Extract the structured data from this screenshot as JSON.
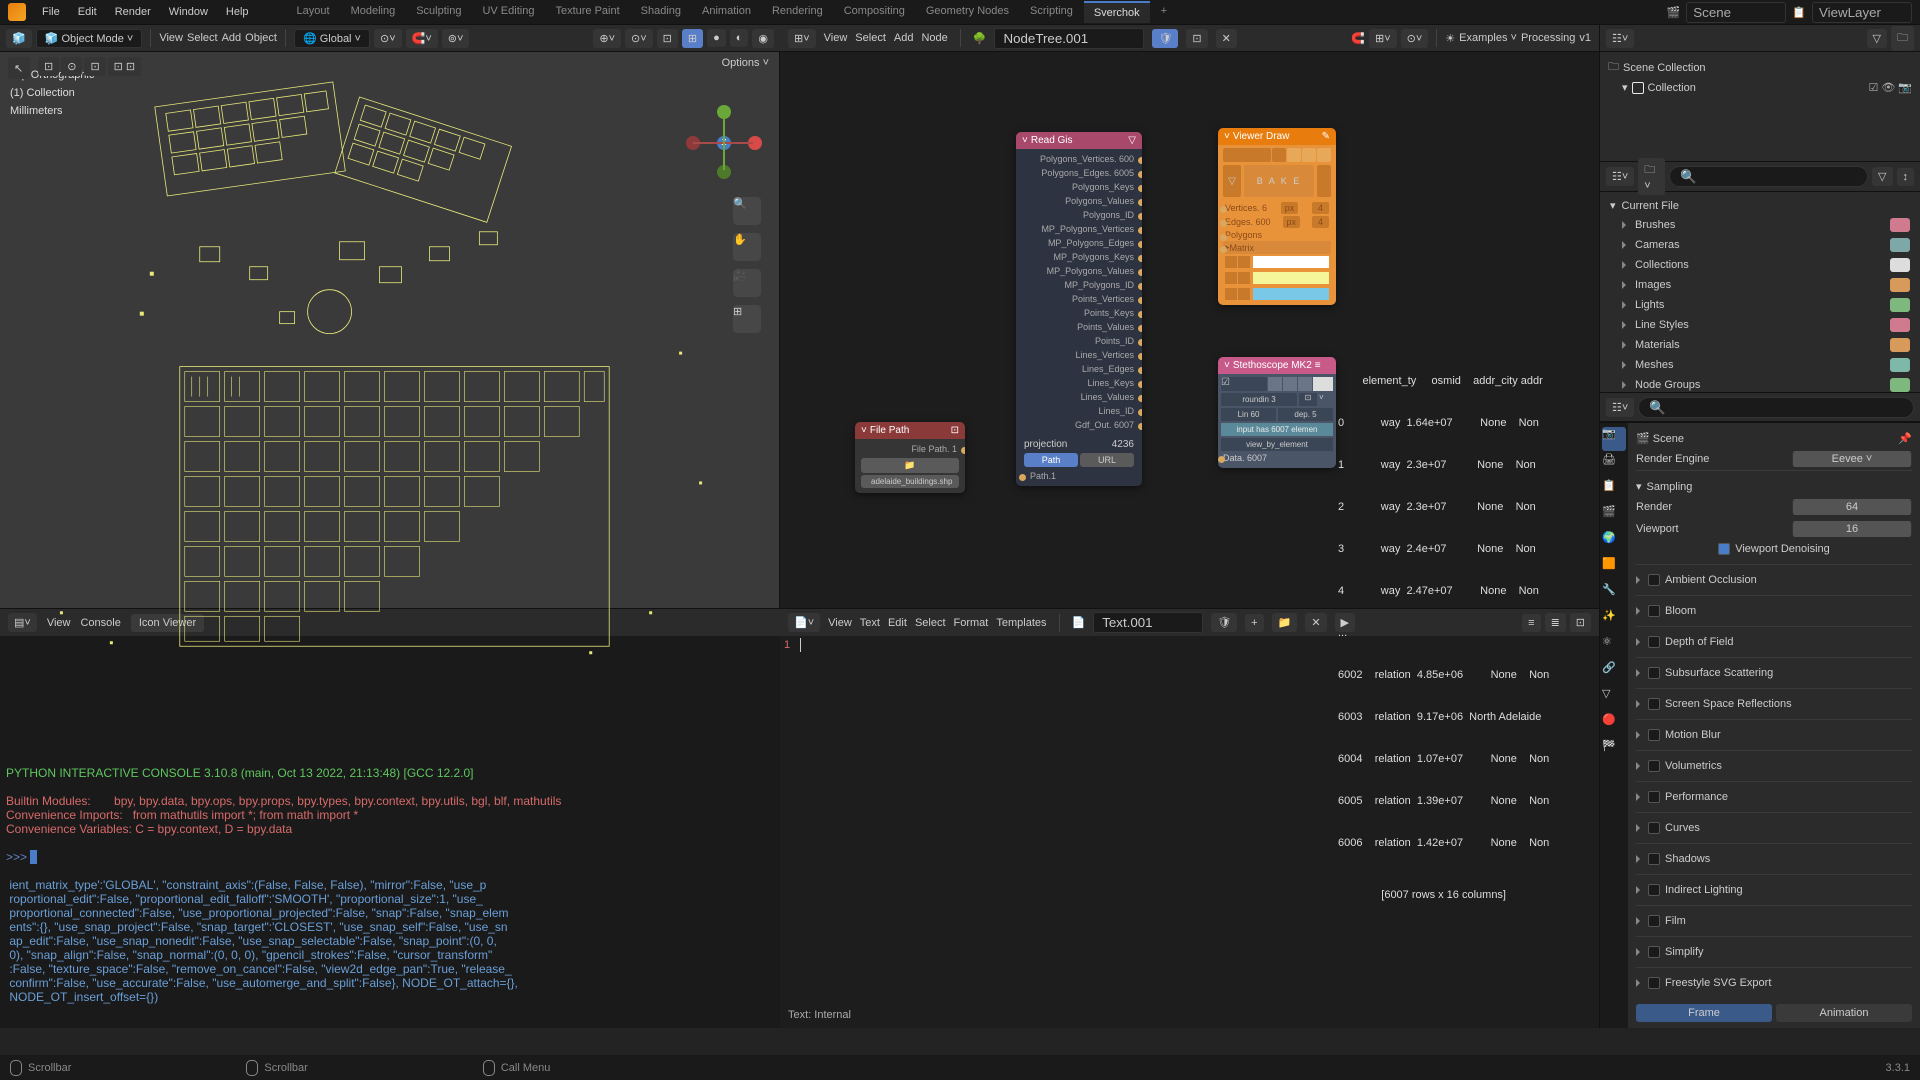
{
  "topbar": {
    "menus": [
      "File",
      "Edit",
      "Render",
      "Window",
      "Help"
    ],
    "workspaces": [
      "Layout",
      "Modeling",
      "Sculpting",
      "UV Editing",
      "Texture Paint",
      "Shading",
      "Animation",
      "Rendering",
      "Compositing",
      "Geometry Nodes",
      "Scripting",
      "Sverchok",
      "+"
    ],
    "active_ws": "Sverchok",
    "scene": "Scene",
    "viewlayer": "ViewLayer"
  },
  "viewport": {
    "mode": "Object Mode",
    "menus": [
      "View",
      "Select",
      "Add",
      "Object"
    ],
    "orientation": "Global",
    "options": "Options",
    "overlay": {
      "l1": "Top Orthographic",
      "l2": "(1) Collection",
      "l3": "Millimeters"
    }
  },
  "node_editor": {
    "menus": [
      "View",
      "Select",
      "Add",
      "Node"
    ],
    "treename": "NodeTree.001",
    "examples": "Examples",
    "processing": "Processing",
    "v": "v1"
  },
  "nodes": {
    "readgis": {
      "title": "Read Gis",
      "outputs": [
        {
          "label": "Polygons_Vertices",
          "val": "600"
        },
        {
          "label": "Polygons_Edges",
          "val": "6005"
        },
        {
          "label": "Polygons_Keys",
          "val": ""
        },
        {
          "label": "Polygons_Values",
          "val": ""
        },
        {
          "label": "Polygons_ID",
          "val": ""
        },
        {
          "label": "MP_Polygons_Vertices",
          "val": ""
        },
        {
          "label": "MP_Polygons_Edges",
          "val": ""
        },
        {
          "label": "MP_Polygons_Keys",
          "val": ""
        },
        {
          "label": "MP_Polygons_Values",
          "val": ""
        },
        {
          "label": "MP_Polygons_ID",
          "val": ""
        },
        {
          "label": "Points_Vertices",
          "val": ""
        },
        {
          "label": "Points_Keys",
          "val": ""
        },
        {
          "label": "Points_Values",
          "val": ""
        },
        {
          "label": "Points_ID",
          "val": ""
        },
        {
          "label": "Lines_Vertices",
          "val": ""
        },
        {
          "label": "Lines_Edges",
          "val": ""
        },
        {
          "label": "Lines_Keys",
          "val": ""
        },
        {
          "label": "Lines_Values",
          "val": ""
        },
        {
          "label": "Lines_ID",
          "val": ""
        },
        {
          "label": "Gdf_Out",
          "val": "6007"
        }
      ],
      "projection": "projection",
      "proj_val": "4236",
      "tab_path": "Path",
      "tab_url": "URL",
      "path_label": "Path",
      "path_val": "1"
    },
    "viewer": {
      "title": "Viewer Draw",
      "bake": "B A K E",
      "vertices": "Vertices. 6",
      "edges": "Edges. 600",
      "polygons": "Polygons",
      "matrix": "Matrix",
      "px": "px",
      "px_val1": "4",
      "px_val2": "4"
    },
    "filepath": {
      "title": "File Path",
      "socket": "File Path",
      "socket_val": "1",
      "value": "adelaide_buildings.shp"
    },
    "stetho": {
      "title": "Stethoscope MK2",
      "rounding": "roundin",
      "rounding_val": "3",
      "lin": "Lin 60",
      "dep": "dep. 5",
      "msg": "input has 6007 elemen",
      "view_by": "view_by_element",
      "data": "Data. 6007"
    }
  },
  "node_table": {
    "header": "        element_ty     osmid    addr_city addr",
    "rows": [
      "0            way  1.64e+07         None    Non",
      "1            way  2.3e+07          None    Non",
      "2            way  2.3e+07          None    Non",
      "3            way  2.4e+07          None    Non",
      "4            way  2.47e+07         None    Non",
      "...",
      "6002    relation  4.85e+06         None    Non",
      "6003    relation  9.17e+06  North Adelaide",
      "6004    relation  1.07e+07         None    Non",
      "6005    relation  1.39e+07         None    Non",
      "6006    relation  1.42e+07         None    Non"
    ],
    "footer": "[6007 rows x 16 columns]"
  },
  "console": {
    "menus": [
      "View",
      "Console"
    ],
    "tab": "Icon Viewer",
    "startup": "PYTHON INTERACTIVE CONSOLE 3.10.8 (main, Oct 13 2022, 21:13:48) [GCC 12.2.0]",
    "builtin": "Builtin Modules:       bpy, bpy.data, bpy.ops, bpy.props, bpy.types, bpy.context, bpy.utils, bgl, blf, mathutils",
    "conv1": "Convenience Imports:   from mathutils import *; from math import *",
    "conv2": "Convenience Variables: C = bpy.context, D = bpy.data",
    "prompt": ">>> ",
    "dump": [
      " ient_matrix_type':'GLOBAL', \"constraint_axis\":(False, False, False), \"mirror\":False, \"use_p",
      " roportional_edit\":False, \"proportional_edit_falloff\":'SMOOTH', \"proportional_size\":1, \"use_",
      " proportional_connected\":False, \"use_proportional_projected\":False, \"snap\":False, \"snap_elem",
      " ents\":{}, \"use_snap_project\":False, \"snap_target\":'CLOSEST', \"use_snap_self\":False, \"use_sn",
      " ap_edit\":False, \"use_snap_nonedit\":False, \"use_snap_selectable\":False, \"snap_point\":(0, 0, ",
      " 0), \"snap_align\":False, \"snap_normal\":(0, 0, 0), \"gpencil_strokes\":False, \"cursor_transform\"",
      " :False, \"texture_space\":False, \"remove_on_cancel\":False, \"view2d_edge_pan\":True, \"release_",
      " confirm\":False, \"use_accurate\":False, \"use_automerge_and_split\":False}, NODE_OT_attach={},",
      " NODE_OT_insert_offset={})"
    ]
  },
  "text_editor": {
    "menus": [
      "View",
      "Text",
      "Edit",
      "Select",
      "Format",
      "Templates"
    ],
    "name": "Text.001",
    "footer": "Text: Internal",
    "line": "1"
  },
  "outliner": {
    "root": "Scene Collection",
    "collection": "Collection"
  },
  "assets": {
    "current": "Current File",
    "items": [
      {
        "label": "Brushes",
        "color": "#cf7a8e"
      },
      {
        "label": "Cameras",
        "color": "#7ea8a8"
      },
      {
        "label": "Collections",
        "color": "#ddd"
      },
      {
        "label": "Images",
        "color": "#d89a5a"
      },
      {
        "label": "Lights",
        "color": "#7eb87e"
      },
      {
        "label": "Line Styles",
        "color": "#cf7a8e"
      },
      {
        "label": "Materials",
        "color": "#d89a5a"
      },
      {
        "label": "Meshes",
        "color": "#7eb8a8"
      },
      {
        "label": "Node Groups",
        "color": "#7eb87e"
      }
    ]
  },
  "props": {
    "scene": "Scene",
    "engine_label": "Render Engine",
    "engine": "Eevee",
    "sampling": "Sampling",
    "render_label": "Render",
    "render_val": "64",
    "viewport_label": "Viewport",
    "viewport_val": "16",
    "denoise": "Viewport Denoising",
    "sections": [
      "Ambient Occlusion",
      "Bloom",
      "Depth of Field",
      "Subsurface Scattering",
      "Screen Space Reflections",
      "Motion Blur",
      "Volumetrics",
      "Performance",
      "Curves",
      "Shadows",
      "Indirect Lighting",
      "Film",
      "Simplify",
      "Freestyle SVG Export"
    ],
    "frame": "Frame",
    "animation": "Animation"
  },
  "statusbar": {
    "scrollbar": "Scrollbar",
    "scrollbar2": "Scrollbar",
    "callmenu": "Call Menu",
    "version": "3.3.1"
  }
}
